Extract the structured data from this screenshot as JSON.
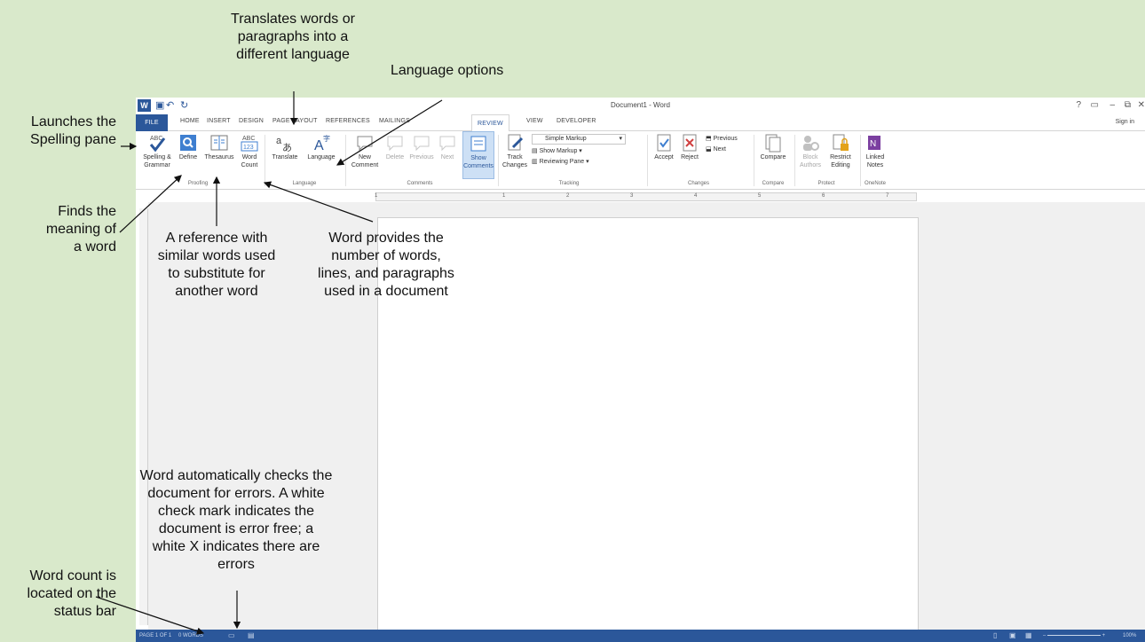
{
  "window": {
    "title": "Document1 - Word",
    "sign_in": "Sign in",
    "help": "?",
    "minimize": "–",
    "restore": "⧉",
    "close": "✕"
  },
  "tabs": [
    "FILE",
    "HOME",
    "INSERT",
    "DESIGN",
    "PAGE LAYOUT",
    "REFERENCES",
    "MAILINGS",
    "REVIEW",
    "VIEW",
    "DEVELOPER"
  ],
  "active_tab": "REVIEW",
  "ribbon": {
    "spelling": "Spelling &\nGrammar",
    "define": "Define",
    "thesaurus": "Thesaurus",
    "word_count": "Word\nCount",
    "translate": "Translate",
    "language": "Language",
    "new_comment": "New\nComment",
    "delete": "Delete",
    "previous": "Previous",
    "next": "Next",
    "show_comments": "Show\nComments",
    "track_changes": "Track\nChanges",
    "simple_markup": "Simple Markup",
    "show_markup": "Show Markup",
    "reviewing_pane": "Reviewing Pane",
    "accept": "Accept",
    "reject": "Reject",
    "prev_change": "Previous",
    "next_change": "Next",
    "compare": "Compare",
    "block_authors": "Block\nAuthors",
    "restrict_editing": "Restrict\nEditing",
    "linked_notes": "Linked\nNotes",
    "groups": [
      "Proofing",
      "Language",
      "Comments",
      "Tracking",
      "Changes",
      "Compare",
      "Protect",
      "OneNote"
    ]
  },
  "ruler_numbers": [
    "1",
    "1",
    "2",
    "3",
    "4",
    "5",
    "6",
    "7"
  ],
  "status": {
    "page": "PAGE 1 OF 1",
    "words": "0 WORDS",
    "zoom": "100%"
  },
  "callouts": {
    "translate": "Translates words or\nparagraphs into a\ndifferent language",
    "language_options": "Language options",
    "spelling_pane": "Launches the\nSpelling pane",
    "define": "Finds the\nmeaning of\na word",
    "thesaurus": "A reference with\nsimilar words used\nto substitute for\nanother word",
    "word_count": "Word provides the\nnumber of words,\nlines, and paragraphs\nused in a document",
    "error_check": "Word automatically checks the\ndocument for errors. A white\ncheck mark indicates the\ndocument is error free; a\nwhite X indicates there are\nerrors",
    "status_word_count": "Word count is\nlocated on the\nstatus bar"
  },
  "colors": {
    "background": "#d9e9cb",
    "word_blue": "#2b579a"
  }
}
